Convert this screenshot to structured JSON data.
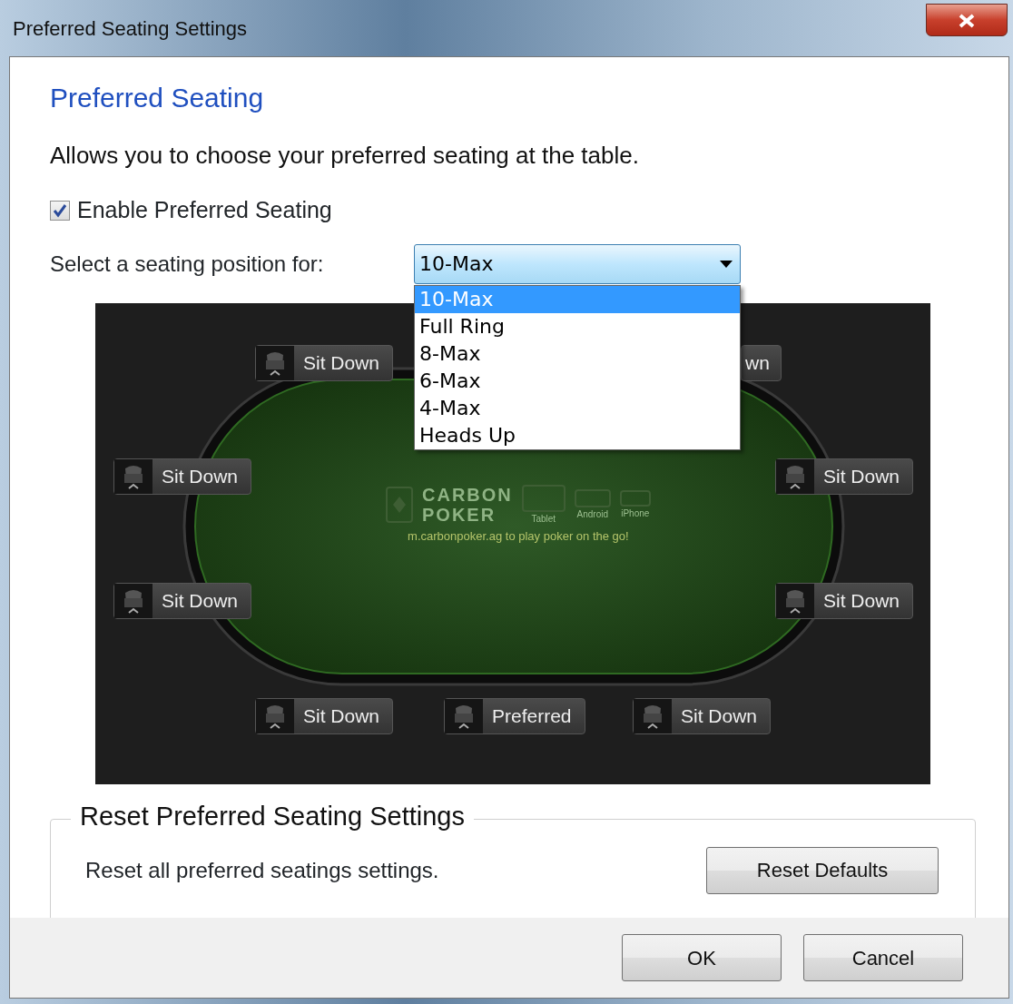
{
  "window": {
    "title": "Preferred Seating Settings"
  },
  "heading": "Preferred Seating",
  "description": "Allows you to choose your preferred seating at the table.",
  "enable_checkbox": {
    "label": "Enable Preferred Seating",
    "checked": true
  },
  "seating_select": {
    "label": "Select a seating position for:",
    "value": "10-Max",
    "expanded": true,
    "options": [
      {
        "label": "10-Max",
        "selected": true
      },
      {
        "label": "Full Ring",
        "selected": false
      },
      {
        "label": "8-Max",
        "selected": false
      },
      {
        "label": "6-Max",
        "selected": false
      },
      {
        "label": "4-Max",
        "selected": false
      },
      {
        "label": "Heads Up",
        "selected": false
      }
    ]
  },
  "table": {
    "logo": {
      "line_1": "CARBON",
      "line_2": "POKER",
      "devices": [
        "Tablet",
        "Android",
        "iPhone"
      ],
      "tagline": "m.carbonpoker.ag to play poker on the go!"
    },
    "seats": [
      {
        "label": "Sit Down",
        "kind": "seat"
      },
      {
        "label": "wn",
        "kind": "covered"
      },
      {
        "label": "Sit Down",
        "kind": "seat"
      },
      {
        "label": "Sit Down",
        "kind": "seat"
      },
      {
        "label": "Sit Down",
        "kind": "seat"
      },
      {
        "label": "Sit Down",
        "kind": "seat"
      },
      {
        "label": "Sit Down",
        "kind": "seat"
      },
      {
        "label": "Preferred",
        "kind": "seat"
      },
      {
        "label": "Sit Down",
        "kind": "seat"
      }
    ]
  },
  "reset_group": {
    "title": "Reset Preferred Seating Settings",
    "text": "Reset all preferred seatings settings.",
    "button": "Reset Defaults"
  },
  "buttons": [
    "OK",
    "Cancel"
  ]
}
